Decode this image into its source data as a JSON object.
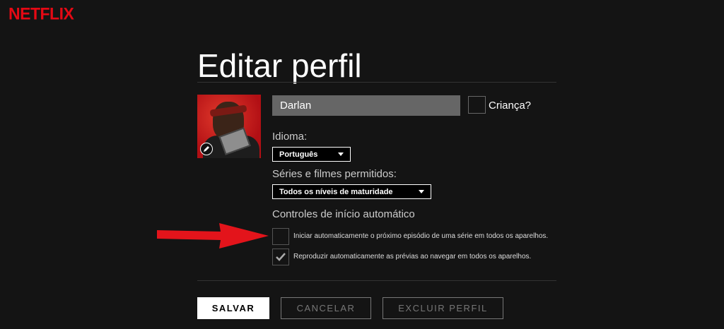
{
  "brand": {
    "logo_text": "NETFLIX",
    "color": "#e50914"
  },
  "page": {
    "title": "Editar perfil"
  },
  "profile": {
    "avatar_icon": "edit-pencil-icon",
    "name_value": "Darlan",
    "kid_label": "Criança?",
    "kid_checked": false
  },
  "language": {
    "label": "Idioma:",
    "selected": "Português"
  },
  "maturity": {
    "label": "Séries e filmes permitidos:",
    "selected": "Todos os níveis de maturidade"
  },
  "autoplay": {
    "section_label": "Controles de início automático",
    "options": [
      {
        "label": "Iniciar automaticamente o próximo episódio de uma série em todos os aparelhos.",
        "checked": false
      },
      {
        "label": "Reproduzir automaticamente as prévias ao navegar em todos os aparelhos.",
        "checked": true
      }
    ]
  },
  "annotation": {
    "arrow_color": "#e3141b"
  },
  "actions": {
    "save": "SALVAR",
    "cancel": "CANCELAR",
    "delete": "EXCLUIR PERFIL"
  }
}
